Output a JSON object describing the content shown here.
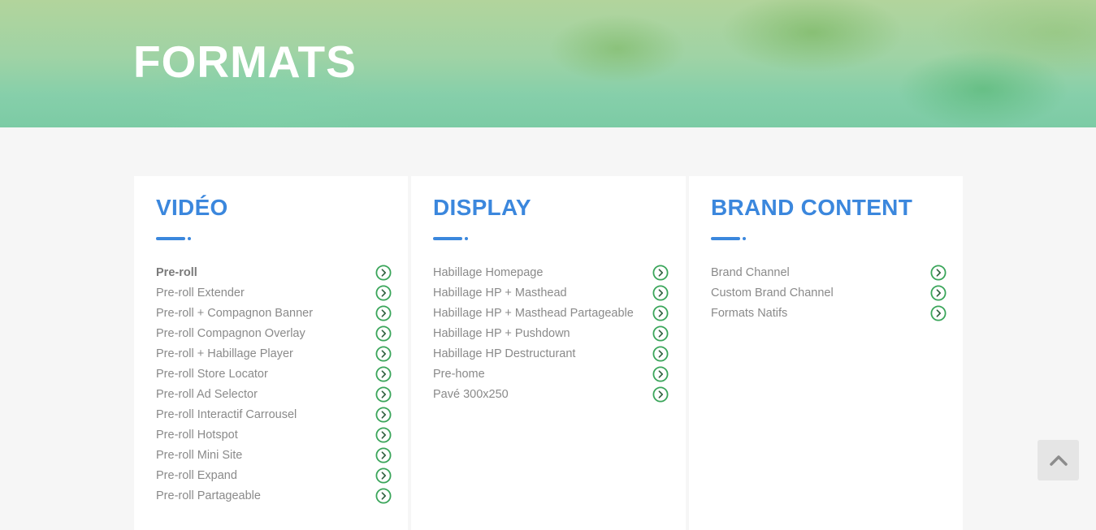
{
  "hero": {
    "title": "FORMATS"
  },
  "colors": {
    "accent": "#3b87dd",
    "arrow": "#3aa55a",
    "text": "#8a8a8a"
  },
  "columns": [
    {
      "title": "VIDÉO",
      "items": [
        {
          "label": "Pre-roll",
          "active": true
        },
        {
          "label": "Pre-roll Extender"
        },
        {
          "label": "Pre-roll + Compagnon Banner"
        },
        {
          "label": "Pre-roll Compagnon Overlay"
        },
        {
          "label": "Pre-roll + Habillage Player"
        },
        {
          "label": "Pre-roll Store Locator"
        },
        {
          "label": "Pre-roll Ad Selector"
        },
        {
          "label": "Pre-roll Interactif Carrousel"
        },
        {
          "label": "Pre-roll Hotspot"
        },
        {
          "label": "Pre-roll Mini Site"
        },
        {
          "label": "Pre-roll Expand"
        },
        {
          "label": "Pre-roll Partageable"
        }
      ]
    },
    {
      "title": "DISPLAY",
      "items": [
        {
          "label": "Habillage Homepage"
        },
        {
          "label": "Habillage HP + Masthead"
        },
        {
          "label": "Habillage HP + Masthead Partageable"
        },
        {
          "label": "Habillage HP + Pushdown"
        },
        {
          "label": "Habillage HP Destructurant"
        },
        {
          "label": "Pre-home"
        },
        {
          "label": "Pavé 300x250"
        }
      ]
    },
    {
      "title": "BRAND CONTENT",
      "items": [
        {
          "label": "Brand Channel"
        },
        {
          "label": "Custom Brand Channel"
        },
        {
          "label": "Formats Natifs"
        }
      ]
    }
  ],
  "icons": {
    "item_arrow": "chevron-right-circle-icon",
    "scroll_top": "chevron-up-icon"
  }
}
